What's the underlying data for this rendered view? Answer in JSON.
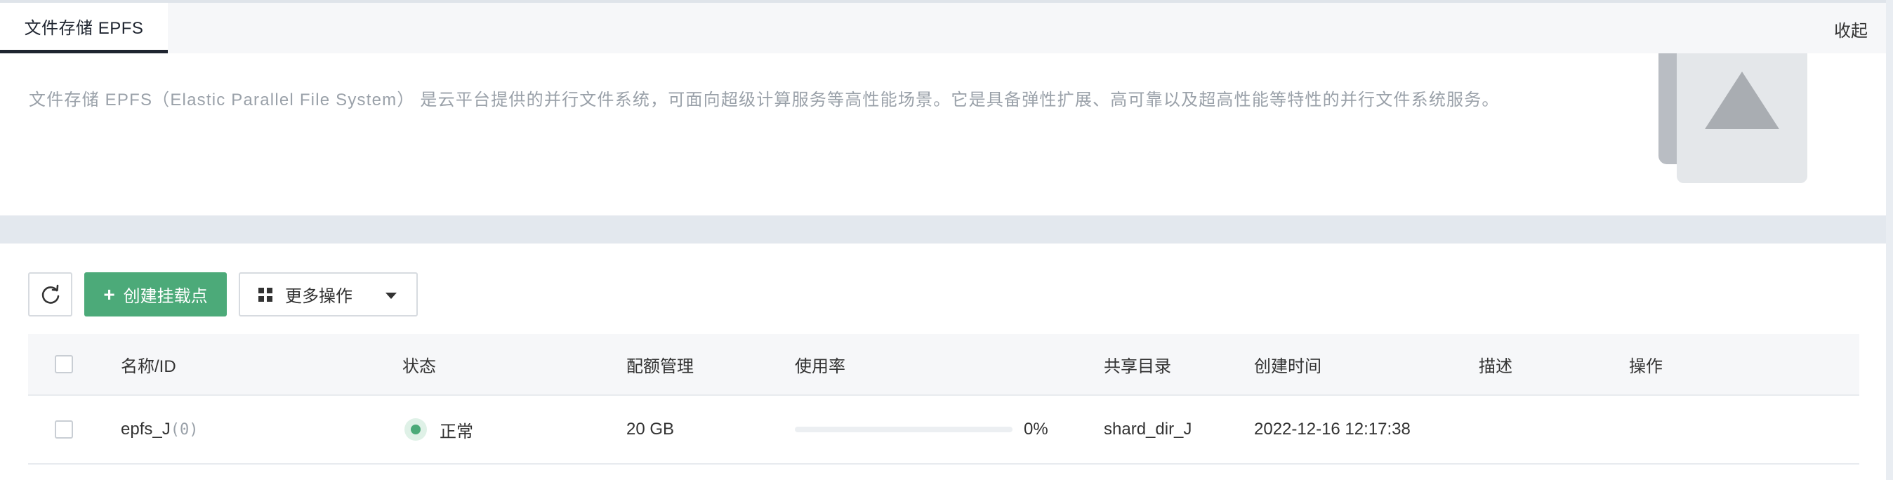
{
  "tab": {
    "label": "文件存储 EPFS"
  },
  "header": {
    "collapse_label": "收起"
  },
  "intro": {
    "description": "文件存储 EPFS（Elastic Parallel File System） 是云平台提供的并行文件系统，可面向超级计算服务等高性能场景。它是具备弹性扩展、高可靠以及超高性能等特性的并行文件系统服务。"
  },
  "toolbar": {
    "refresh_icon": "refresh-icon",
    "create_label": "创建挂载点",
    "more_label": "更多操作"
  },
  "table": {
    "headers": {
      "name": "名称/ID",
      "status": "状态",
      "quota": "配额管理",
      "usage": "使用率",
      "share_dir": "共享目录",
      "created": "创建时间",
      "desc": "描述",
      "ops": "操作"
    },
    "rows": [
      {
        "name": "epfs_J",
        "id_suffix": "(0)",
        "status": "正常",
        "quota": "20 GB",
        "usage_percent": 0,
        "usage_label": "0%",
        "share_dir": "shard_dir_J",
        "created": "2022-12-16 12:17:38",
        "desc": ""
      }
    ]
  },
  "colors": {
    "accent": "#4caa79",
    "tab_underline": "#1f2530"
  }
}
